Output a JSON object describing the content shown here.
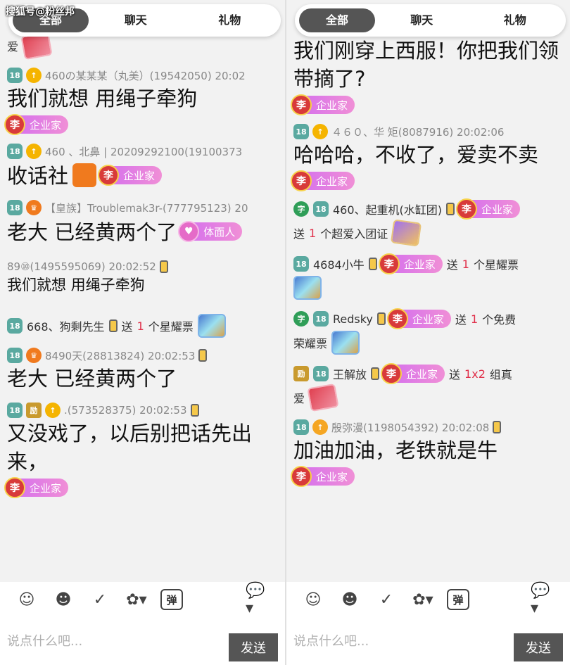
{
  "watermark": "搜狐号@粉丝邦",
  "tabs": [
    "全部",
    "聊天",
    "礼物"
  ],
  "composer": {
    "placeholder": "说点什么吧...",
    "send_label": "发送",
    "dan_label": "弹"
  },
  "left": {
    "top_fragment": "爱",
    "items": [
      {
        "meta": "460の某某某（丸美）(19542050)  20:02",
        "text": "我们就想  用绳子牵狗",
        "badge": "企业家"
      },
      {
        "meta": "460 、北鼻 |  20209292100(19100373",
        "text": "收话社",
        "badge": "企业家"
      },
      {
        "meta": "【皇族】Troublemak3r-(777795123)  20",
        "text": "老大 已经黄两个了",
        "badge": "体面人"
      },
      {
        "meta": "89⑩(1495595069)  20:02:52",
        "text": "我们就想  用绳子牵狗"
      },
      {
        "name": "668、狗剩先生",
        "send": "送",
        "count": "1",
        "gift": "个星耀票"
      },
      {
        "meta": "8490天(28813824)  20:02:53",
        "text": "老大 已经黄两个了"
      },
      {
        "meta": ".(573528375)  20:02:53",
        "text": "又没戏了，以后别把话先出来，",
        "badge": "企业家"
      }
    ]
  },
  "right": {
    "top_text": "我们刚穿上西服！你把我们领带摘了?",
    "top_badge": "企业家",
    "items": [
      {
        "meta": "４６０、华 矩(8087916)  20:02:06",
        "text": "哈哈哈，不收了，爱卖不卖",
        "badge": "企业家"
      },
      {
        "name": "460、起重机(水缸团)",
        "badge": "企业家",
        "send": "送",
        "count": "1",
        "gift": "个超爱入团证"
      },
      {
        "name": "4684小牛",
        "badge": "企业家",
        "send": "送",
        "count": "1",
        "gift": "个星耀票"
      },
      {
        "name": "Redsky",
        "badge": "企业家",
        "send": "送",
        "count": "1",
        "gift": "个免费",
        "gift2": "荣耀票"
      },
      {
        "name": "王解放",
        "badge": "企业家",
        "send": "送",
        "count": "1x2",
        "gift": "组真",
        "gift2": "爱"
      },
      {
        "meta": "殷弥漫(1198054392)  20:02:08",
        "text": "加油加油，老铁就是牛",
        "badge": "企业家"
      }
    ]
  }
}
